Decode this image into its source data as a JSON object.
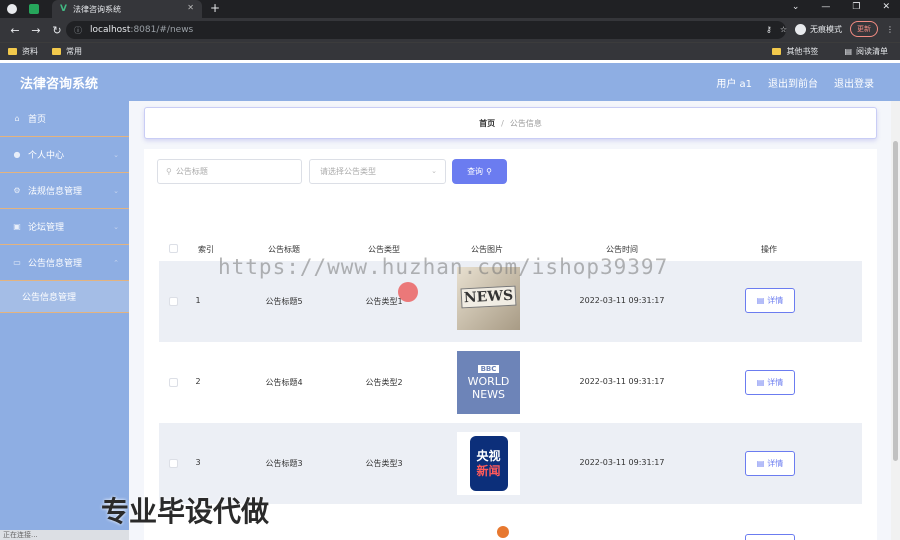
{
  "browser": {
    "tab_title": "法律咨询系统",
    "tab_new": "+",
    "url_info": "ⓘ",
    "url_host": "localhost",
    "url_path": ":8081/#/news",
    "incognito": "无痕模式",
    "update": "更新",
    "bookmarks": [
      "资料",
      "常用"
    ],
    "bookmarks_right": [
      "其他书签",
      "阅读清单"
    ],
    "status": "正在连接..."
  },
  "header": {
    "title": "法律咨询系统",
    "user": "用户 a1",
    "back_admin": "退出到前台",
    "logout": "退出登录"
  },
  "sidebar": {
    "items": [
      {
        "label": "首页",
        "icon": "home-icon"
      },
      {
        "label": "个人中心",
        "icon": "user-icon"
      },
      {
        "label": "法规信息管理",
        "icon": "gear-icon"
      },
      {
        "label": "论坛管理",
        "icon": "doc-icon"
      },
      {
        "label": "公告信息管理",
        "icon": "folder-icon"
      }
    ],
    "sub_item": "公告信息管理"
  },
  "breadcrumb": {
    "home": "首页",
    "sep": "/",
    "current": "公告信息"
  },
  "search": {
    "title_placeholder": "公告标题",
    "type_placeholder": "请选择公告类型",
    "query": "查询"
  },
  "table": {
    "headers": [
      "索引",
      "公告标题",
      "公告类型",
      "公告图片",
      "公告时间",
      "操作"
    ],
    "rows": [
      {
        "index": "1",
        "title": "公告标题5",
        "type": "公告类型1",
        "image": "news-newspaper",
        "time": "2022-03-11 09:31:17",
        "action": "详情"
      },
      {
        "index": "2",
        "title": "公告标题4",
        "type": "公告类型2",
        "image": "bbc-world-news",
        "time": "2022-03-11 09:31:17",
        "action": "详情"
      },
      {
        "index": "3",
        "title": "公告标题3",
        "type": "公告类型3",
        "image": "cctv-news",
        "time": "2022-03-11 09:31:17",
        "action": "详情"
      }
    ]
  },
  "thumb_texts": {
    "news": "NEWS",
    "bbc": "BBC",
    "world": "WORLD",
    "news2": "NEWS",
    "cctv1": "央视",
    "cctv2": "新闻"
  },
  "watermark": "https://www.huzhan.com/ishop39397",
  "watermark_cn": "专业毕设代做",
  "colors": {
    "header": "#8eaee3",
    "accent": "#6b7cf0"
  }
}
